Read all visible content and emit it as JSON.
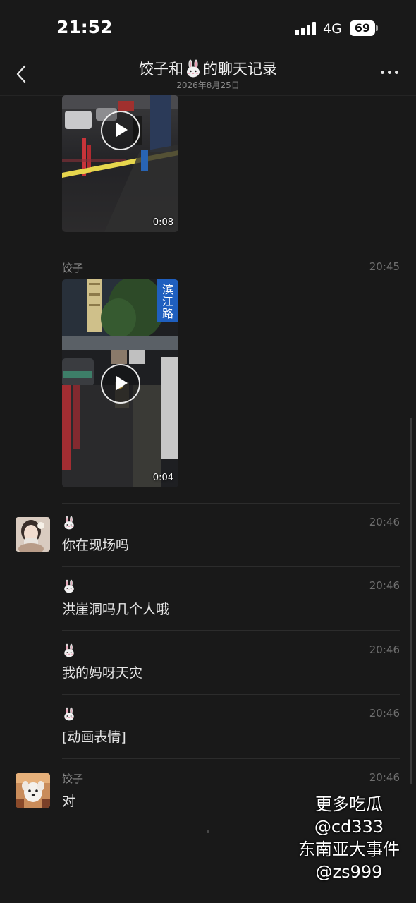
{
  "status_bar": {
    "time": "21:52",
    "network": "4G",
    "battery": "69"
  },
  "header": {
    "title_prefix": "饺子和",
    "title_suffix": "的聊天记录",
    "title_icon": "bunny-emoji-icon",
    "date": "2026年8月25日"
  },
  "messages": [
    {
      "type": "video",
      "duration": "0:08"
    },
    {
      "type": "video",
      "sender": "饺子",
      "time": "20:45",
      "duration": "0:04"
    },
    {
      "type": "text",
      "sender_icon": "bunny-emoji-icon",
      "time": "20:46",
      "text": "你在现场吗"
    },
    {
      "type": "text",
      "sender_icon": "bunny-emoji-icon",
      "time": "20:46",
      "text": "洪崖洞吗几个人哦"
    },
    {
      "type": "text",
      "sender_icon": "bunny-emoji-icon",
      "time": "20:46",
      "text": "我的妈呀天灾"
    },
    {
      "type": "text",
      "sender_icon": "bunny-emoji-icon",
      "time": "20:46",
      "text": "[动画表情]"
    },
    {
      "type": "text",
      "sender": "饺子",
      "time": "20:46",
      "text": "对"
    }
  ],
  "watermark": {
    "line1": "更多吃瓜",
    "line2": "@cd333",
    "line3": "东南亚大事件",
    "line4": "@zs999"
  },
  "colors": {
    "background": "#191919",
    "divider": "#2c2c2c",
    "muted_text": "#8a8a8a"
  }
}
